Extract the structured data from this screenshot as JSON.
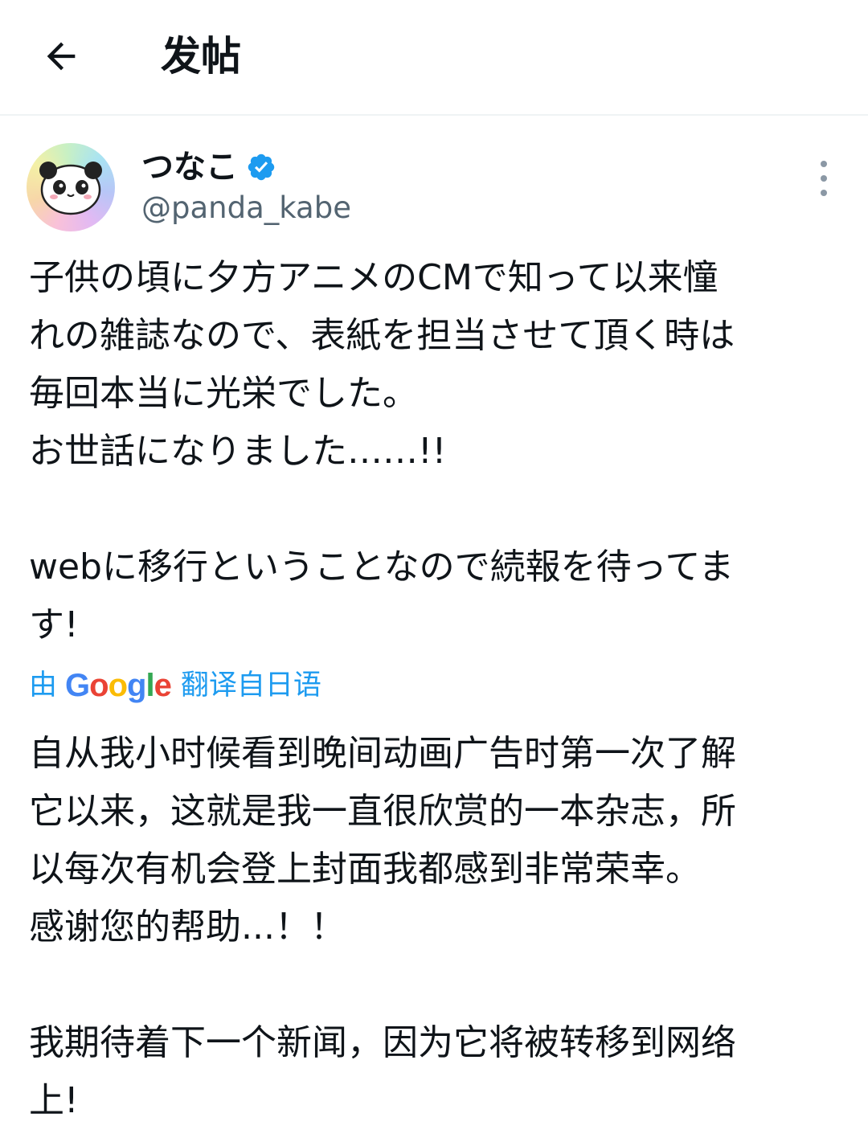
{
  "header": {
    "title": "发帖",
    "back_icon": "arrow-left-icon"
  },
  "author": {
    "display_name": "つなこ",
    "handle": "@panda_kabe",
    "verified": true,
    "verified_color": "#1d9bf0",
    "avatar_icon": "panda-avatar"
  },
  "post": {
    "original_text": "子供の頃に夕方アニメのCMで知って以来憧\nれの雑誌なので、表紙を担当させて頂く時は\n毎回本当に光栄でした。\nお世話になりました……!!\n\nwebに移行ということなので続報を待ってま\nす!",
    "translation": {
      "prefix": "由",
      "provider": "Google",
      "suffix": "翻译自日语",
      "color": "#1d9bf0"
    },
    "translated_text": "自从我小时候看到晚间动画广告时第一次了解\n它以来，这就是我一直很欣赏的一本杂志，所\n以每次有机会登上封面我都感到非常荣幸。\n感谢您的帮助...！！\n\n我期待着下一个新闻，因为它将被转移到网络\n上!"
  },
  "colors": {
    "text": "#0f1419",
    "secondary": "#536471",
    "divider": "#eff3f4"
  }
}
